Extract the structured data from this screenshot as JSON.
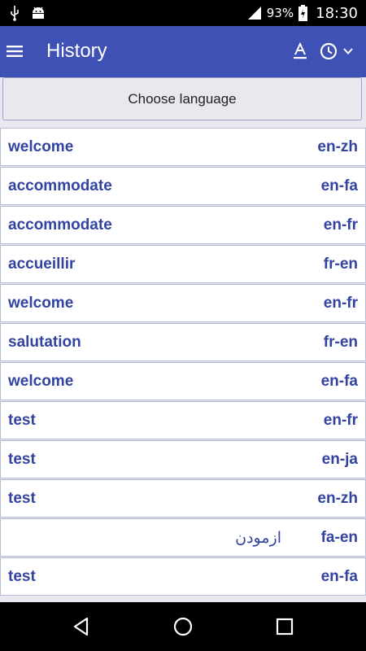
{
  "status_bar": {
    "battery": "93%",
    "time": "18:30",
    "icons": [
      "usb-icon",
      "android-icon",
      "signal-icon",
      "battery-charging-icon"
    ]
  },
  "app_bar": {
    "title": "History",
    "icons": [
      "menu-icon",
      "font-size-icon",
      "history-clock-icon",
      "chevron-down-icon"
    ],
    "color": "#3f51b5"
  },
  "choose_language": {
    "label": "Choose language"
  },
  "history": [
    {
      "word": "welcome",
      "lang": "en-zh"
    },
    {
      "word": "accommodate",
      "lang": "en-fa"
    },
    {
      "word": "accommodate",
      "lang": "en-fr"
    },
    {
      "word": "accueillir",
      "lang": "fr-en"
    },
    {
      "word": "welcome",
      "lang": "en-fr"
    },
    {
      "word": "salutation",
      "lang": "fr-en"
    },
    {
      "word": "welcome",
      "lang": "en-fa"
    },
    {
      "word": "test",
      "lang": "en-fr"
    },
    {
      "word": "test",
      "lang": "en-ja"
    },
    {
      "word": "test",
      "lang": "en-zh"
    },
    {
      "word": "ازمودن",
      "lang": "fa-en"
    },
    {
      "word": "test",
      "lang": "en-fa"
    }
  ],
  "nav_bar": {
    "icons": [
      "back-icon",
      "home-icon",
      "recents-icon"
    ]
  }
}
